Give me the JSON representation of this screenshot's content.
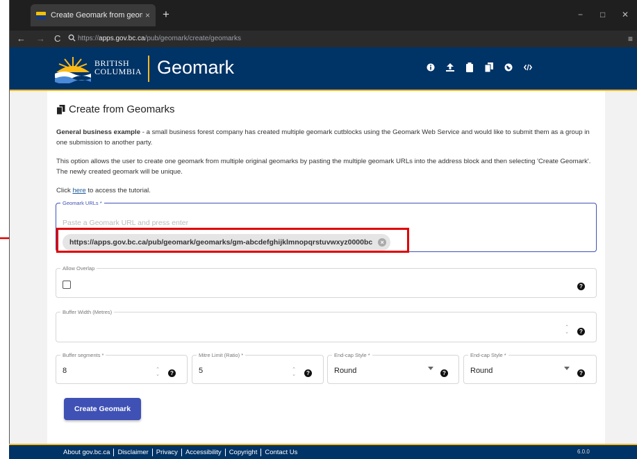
{
  "browser": {
    "tab_title": "Create Geomark from geomarks",
    "tab_close": "×",
    "new_tab": "+",
    "url_prefix": "https://",
    "url_host": "apps.gov.bc.ca",
    "url_path": "/pub/geomark/create/geomarks",
    "win_minimize": "−",
    "win_maximize": "□",
    "win_close": "✕",
    "menu_icon": "≡"
  },
  "header": {
    "logo_line1": "BRITISH",
    "logo_line2": "COLUMBIA",
    "brand": "Geomark",
    "icons": [
      "info-icon",
      "upload-icon",
      "clipboard-icon",
      "copy-icon",
      "globe-icon",
      "code-icon"
    ]
  },
  "page": {
    "title": "Create from Geomarks",
    "example_bold": "General business example",
    "example_text": " - a small business forest company has created multiple geomark cutblocks using the Geomark Web Service and would like to submit them as a group in one submission to another party.",
    "description": "This option allows the user to create one geomark from multiple original geomarks by pasting the multiple geomark URLs into the address block and then selecting 'Create Geomark'. The newly created geomark will be unique.",
    "tutorial_prefix": "Click ",
    "tutorial_link": "here",
    "tutorial_suffix": " to access the tutorial."
  },
  "form": {
    "urls_label": "Geomark URLs *",
    "urls_placeholder": "Paste a Geomark URL and press enter",
    "url_chip": "https://apps.gov.bc.ca/pub/geomark/geomarks/gm-abcdefghijklmnopqrstuvwxyz0000bc",
    "chip_remove": "×",
    "allow_overlap_label": "Allow Overlap",
    "allow_overlap_checked": false,
    "buffer_width_label": "Buffer Width (Metres)",
    "buffer_width_value": "",
    "buffer_segments_label": "Buffer segments *",
    "buffer_segments_value": "8",
    "mitre_limit_label": "Mitre Limit (Ratio) *",
    "mitre_limit_value": "5",
    "endcap_style_label": "End-cap Style *",
    "endcap_style_value": "Round",
    "endcap_style2_label": "End-cap Style *",
    "endcap_style2_value": "Round",
    "help_glyph": "?",
    "spin_up": "⌃",
    "spin_down": "⌄",
    "submit_label": "Create Geomark"
  },
  "footer": {
    "links": [
      "About gov.bc.ca",
      "Disclaimer",
      "Privacy",
      "Accessibility",
      "Copyright",
      "Contact Us"
    ],
    "version": "6.0.0"
  },
  "colors": {
    "gov_blue": "#003366",
    "gov_gold": "#fcba19",
    "primary": "#3f51b5",
    "highlight": "#e00000"
  }
}
